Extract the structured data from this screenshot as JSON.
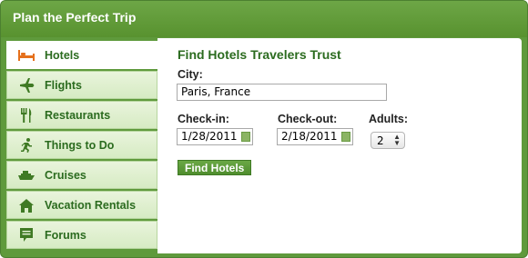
{
  "header": {
    "title": "Plan the Perfect Trip"
  },
  "tabs": [
    {
      "label": "Hotels",
      "icon": "bed-icon",
      "active": true
    },
    {
      "label": "Flights",
      "icon": "airplane-icon"
    },
    {
      "label": "Restaurants",
      "icon": "fork-knife-icon"
    },
    {
      "label": "Things to Do",
      "icon": "running-person-icon"
    },
    {
      "label": "Cruises",
      "icon": "ship-icon"
    },
    {
      "label": "Vacation Rentals",
      "icon": "house-icon"
    },
    {
      "label": "Forums",
      "icon": "speech-bubble-icon"
    }
  ],
  "form": {
    "title": "Find Hotels Travelers Trust",
    "city_label": "City:",
    "city_value": "Paris, France",
    "checkin_label": "Check-in:",
    "checkin_value": "1/28/2011",
    "checkout_label": "Check-out:",
    "checkout_value": "2/18/2011",
    "adults_label": "Adults:",
    "adults_value": "2",
    "submit_label": "Find Hotels"
  },
  "colors": {
    "brand_green": "#5f9a3c",
    "text_green": "#2b6b1f",
    "icon_orange": "#e5701c"
  }
}
